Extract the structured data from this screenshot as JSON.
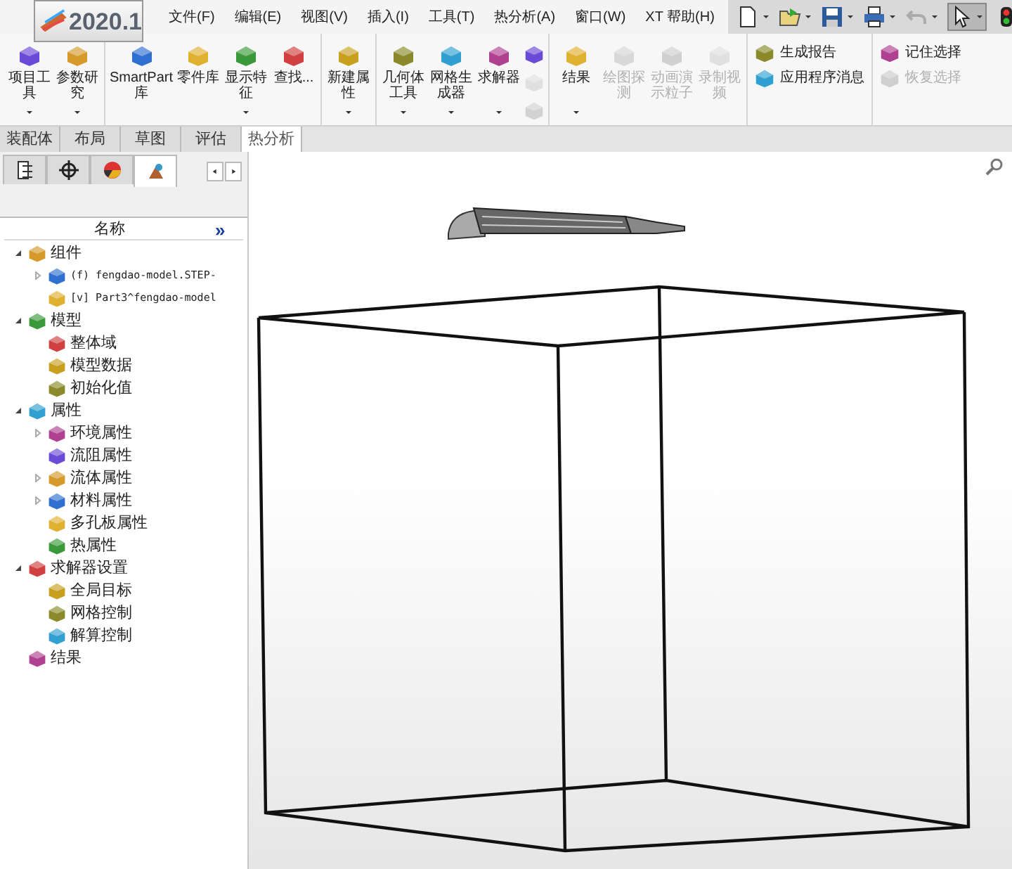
{
  "logo": {
    "text": "2020.1"
  },
  "menu": [
    "文件(F)",
    "编辑(E)",
    "视图(V)",
    "插入(I)",
    "工具(T)",
    "热分析(A)",
    "窗口(W)",
    "XT 帮助(H)"
  ],
  "quick_tools": [
    {
      "kind": "new",
      "disabled": false,
      "selected": false
    },
    {
      "kind": "open",
      "disabled": false,
      "selected": false
    },
    {
      "kind": "save",
      "disabled": false,
      "selected": false
    },
    {
      "kind": "print",
      "disabled": false,
      "selected": false
    },
    {
      "kind": "undo",
      "disabled": true,
      "selected": false
    },
    {
      "kind": "select",
      "disabled": false,
      "selected": true
    },
    {
      "kind": "light",
      "disabled": false,
      "selected": false
    }
  ],
  "ribbon": [
    {
      "items": [
        {
          "kind": "large",
          "label": "项目工具",
          "dropdown": true,
          "disabled": false
        },
        {
          "kind": "large",
          "label": "参数研究",
          "dropdown": true,
          "disabled": false
        }
      ]
    },
    {
      "items": [
        {
          "kind": "large",
          "label": "SmartPart库",
          "dropdown": false,
          "disabled": false
        },
        {
          "kind": "large",
          "label": "零件库",
          "dropdown": false,
          "disabled": false
        },
        {
          "kind": "large",
          "label": "显示特征",
          "dropdown": true,
          "disabled": false
        },
        {
          "kind": "large",
          "label": "查找...",
          "dropdown": false,
          "disabled": false
        }
      ]
    },
    {
      "items": [
        {
          "kind": "large",
          "label": "新建属性",
          "dropdown": true,
          "disabled": false
        }
      ]
    },
    {
      "items": [
        {
          "kind": "large",
          "label": "几何体工具",
          "dropdown": true,
          "disabled": false
        },
        {
          "kind": "large",
          "label": "网格生成器",
          "dropdown": true,
          "disabled": false
        },
        {
          "kind": "large",
          "label": "求解器",
          "dropdown": true,
          "disabled": false
        },
        {
          "kind": "icons",
          "buttons": [
            {
              "disabled": false
            },
            {
              "disabled": true
            },
            {
              "disabled": true
            }
          ]
        }
      ]
    },
    {
      "items": [
        {
          "kind": "large",
          "label": "结果",
          "dropdown": true,
          "disabled": false
        },
        {
          "kind": "large",
          "label": "绘图探测",
          "dropdown": false,
          "disabled": true
        },
        {
          "kind": "large",
          "label": "动画演示粒子",
          "dropdown": false,
          "disabled": true
        },
        {
          "kind": "large",
          "label": "录制视频",
          "dropdown": false,
          "disabled": true
        }
      ]
    },
    {
      "items": [
        {
          "kind": "small",
          "rows": [
            {
              "label": "生成报告",
              "disabled": false
            },
            {
              "label": "应用程序消息",
              "disabled": false
            }
          ]
        }
      ]
    },
    {
      "items": [
        {
          "kind": "small",
          "rows": [
            {
              "label": "记住选择",
              "disabled": false
            },
            {
              "label": "恢复选择",
              "disabled": true
            }
          ]
        }
      ]
    }
  ],
  "tabs": [
    {
      "label": "装配体",
      "selected": false
    },
    {
      "label": "布局",
      "selected": false
    },
    {
      "label": "草图",
      "selected": false
    },
    {
      "label": "评估",
      "selected": false
    },
    {
      "label": "热分析",
      "selected": true
    }
  ],
  "panel_tabs": [
    {
      "selected": false
    },
    {
      "selected": false
    },
    {
      "selected": false
    },
    {
      "selected": true
    }
  ],
  "tree": {
    "header": "名称",
    "more": "»",
    "items": [
      {
        "label": "组件",
        "expanded": true,
        "children": [
          {
            "label": "(f) fengdao-model.STEP-",
            "expanded": false,
            "mono": true
          },
          {
            "label": "[v] Part3^fengdao-model",
            "mono": true
          }
        ]
      },
      {
        "label": "模型",
        "expanded": true,
        "children": [
          {
            "label": "整体域"
          },
          {
            "label": "模型数据"
          },
          {
            "label": "初始化值"
          }
        ]
      },
      {
        "label": "属性",
        "expanded": true,
        "children": [
          {
            "label": "环境属性",
            "expanded": false
          },
          {
            "label": "流阻属性"
          },
          {
            "label": "流体属性",
            "expanded": false
          },
          {
            "label": "材料属性",
            "expanded": false
          },
          {
            "label": "多孔板属性"
          },
          {
            "label": "热属性"
          }
        ]
      },
      {
        "label": "求解器设置",
        "expanded": true,
        "children": [
          {
            "label": "全局目标"
          },
          {
            "label": "网格控制"
          },
          {
            "label": "解算控制"
          }
        ]
      },
      {
        "label": "结果"
      }
    ]
  }
}
